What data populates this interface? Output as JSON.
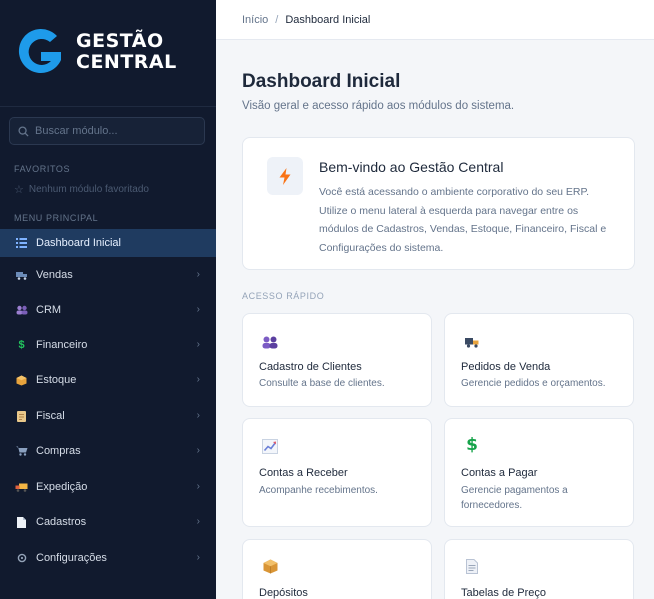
{
  "brand": {
    "line1": "GESTÃO",
    "line2": "CENTRAL",
    "accent": "#1e9bea"
  },
  "sidebar": {
    "search_placeholder": "Buscar módulo...",
    "favorites_label": "FAVORITOS",
    "favorites_empty": "Nenhum módulo favoritado",
    "main_menu_label": "MENU PRINCIPAL",
    "items": [
      {
        "label": "Dashboard Inicial",
        "icon": "list-icon",
        "active": true
      },
      {
        "label": "Vendas",
        "icon": "truck-icon"
      },
      {
        "label": "CRM",
        "icon": "users-icon"
      },
      {
        "label": "Financeiro",
        "icon": "dollar-icon"
      },
      {
        "label": "Estoque",
        "icon": "box-icon"
      },
      {
        "label": "Fiscal",
        "icon": "document-icon"
      },
      {
        "label": "Compras",
        "icon": "cart-icon"
      },
      {
        "label": "Expedição",
        "icon": "delivery-truck-icon"
      },
      {
        "label": "Cadastros",
        "icon": "file-icon"
      },
      {
        "label": "Configurações",
        "icon": "gear-icon"
      }
    ]
  },
  "breadcrumb": {
    "home": "Início",
    "separator": "/",
    "current": "Dashboard Inicial"
  },
  "page": {
    "title": "Dashboard Inicial",
    "subtitle": "Visão geral e acesso rápido aos módulos do sistema."
  },
  "welcome": {
    "title": "Bem-vindo ao Gestão Central",
    "text": "Você está acessando o ambiente corporativo do seu ERP. Utilize o menu lateral à esquerda para navegar entre os módulos de Cadastros, Vendas, Estoque, Financeiro, Fiscal e Configurações do sistema."
  },
  "quick_access": {
    "label": "ACESSO RÁPIDO",
    "cards": [
      {
        "title": "Cadastro de Clientes",
        "desc": "Consulte a base de clientes.",
        "icon": "users-icon"
      },
      {
        "title": "Pedidos de Venda",
        "desc": "Gerencie pedidos e orçamentos.",
        "icon": "truck-icon"
      },
      {
        "title": "Contas a Receber",
        "desc": "Acompanhe recebimentos.",
        "icon": "chart-up-icon"
      },
      {
        "title": "Contas a Pagar",
        "desc": "Gerencie pagamentos a fornecedores.",
        "icon": "dollar-icon"
      },
      {
        "title": "Depósitos",
        "desc": "",
        "icon": "box-icon"
      },
      {
        "title": "Tabelas de Preço",
        "desc": "",
        "icon": "document-icon"
      }
    ]
  }
}
